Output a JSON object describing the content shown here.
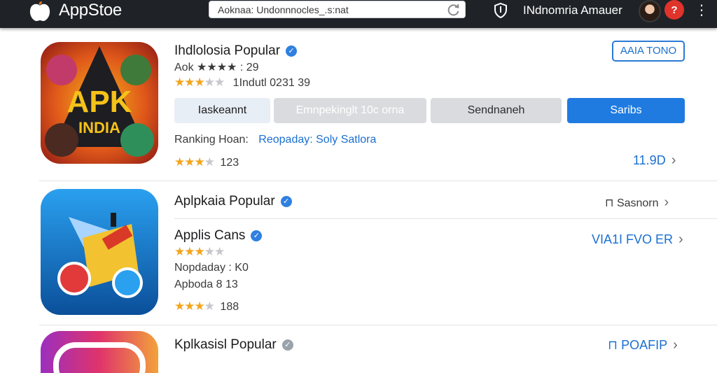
{
  "header": {
    "app_title": "AppStoe",
    "url": "Aoknaa: Undonnnocles_.s:nat",
    "username": "INdnomria Amauer",
    "notification_badge": "?"
  },
  "app1": {
    "name": "Ihdlolosia Popular",
    "rating_text": "Aok ★★★★ : 29",
    "stars_row_text": "1Indutl 0231 39",
    "action_button": "AAIA TONO",
    "tabs": [
      "Iaskeannt",
      "Emnpekinglt 10c orna",
      "Sendnaneh",
      "Saribs"
    ],
    "ranking_label": "Ranking Hoan:",
    "ranking_value": "Reopaday: Soly Satlora",
    "review_count": "123",
    "price": "11.9D"
  },
  "app2": {
    "name": "Aplpkaia Popular",
    "side_text": "Sasnorn",
    "subtitle": "Applis Cans",
    "action_link": "VIA1I FVO ER",
    "line1": "Nopdaday : K0",
    "line2": "Apboda 8 13",
    "review_count": "188"
  },
  "app3": {
    "name": "Kplkasisl Popular",
    "action_link": "POAFIP"
  },
  "colors": {
    "topbar": "#1f2327",
    "accent_blue": "#2a7ad6",
    "star": "#f3a51d"
  }
}
